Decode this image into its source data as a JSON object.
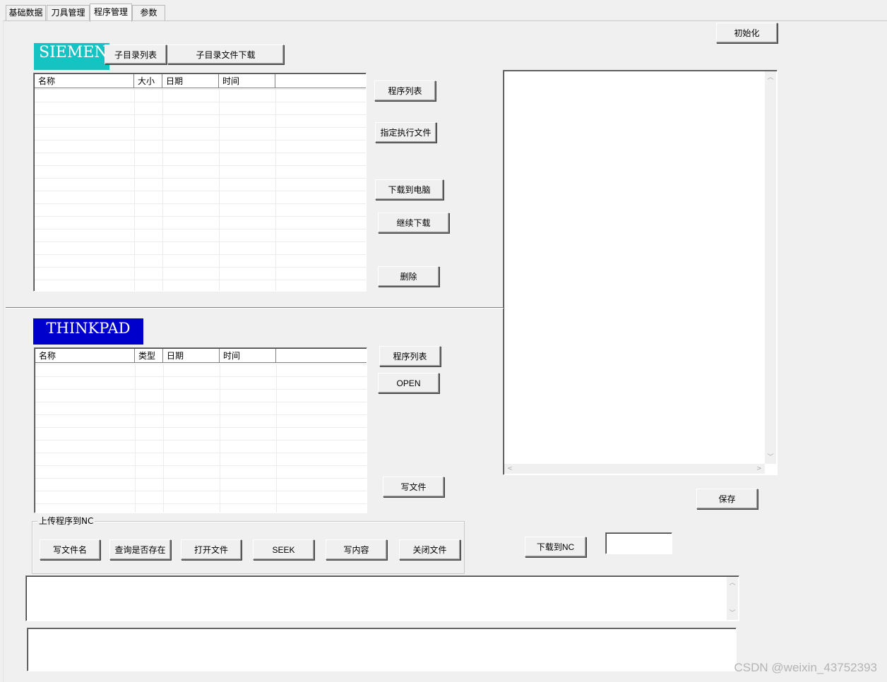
{
  "tabs": [
    {
      "label": "基础数据"
    },
    {
      "label": "刀具管理"
    },
    {
      "label": "程序管理"
    },
    {
      "label": "参数"
    }
  ],
  "init_button": "初始化",
  "siemens": {
    "logo": "SIEMENS",
    "subdir_list_button": "子目录列表",
    "subdir_download_button": "子目录文件下载",
    "columns": [
      "名称",
      "大小",
      "日期",
      "时间"
    ],
    "rows": []
  },
  "siemens_actions": {
    "program_list": "程序列表",
    "set_exec_file": "指定执行文件",
    "download_to_pc": "下载到电脑",
    "continue_download": "继续下载",
    "delete": "删除"
  },
  "thinkpad": {
    "logo": "THINKPAD",
    "columns": [
      "名称",
      "类型",
      "日期",
      "时间"
    ],
    "rows": []
  },
  "thinkpad_actions": {
    "program_list": "程序列表",
    "open": "OPEN",
    "write_file": "写文件"
  },
  "upload_group": {
    "label": "上传程序到NC",
    "buttons": [
      "写文件名",
      "查询是否存在",
      "打开文件",
      "SEEK",
      "写内容",
      "关闭文件"
    ]
  },
  "save_button": "保存",
  "download_nc_button": "下载到NC",
  "nc_input_value": "",
  "editor_text": "",
  "log_text": "",
  "status_text": "",
  "watermark": "CSDN @weixin_43752393"
}
